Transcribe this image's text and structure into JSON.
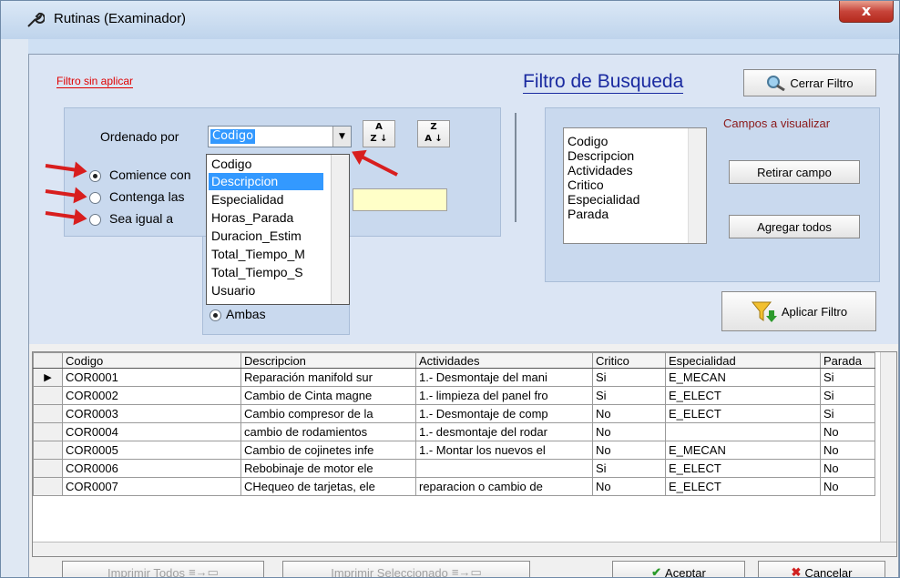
{
  "window": {
    "title": "Rutinas (Examinador)",
    "close_glyph": "x"
  },
  "filter": {
    "status": "Filtro sin aplicar",
    "title": "Filtro de Busqueda",
    "close_filter_label": "Cerrar Filtro",
    "order_label": "Ordenado por",
    "order_value": "Codigo",
    "sort_asc": [
      "A",
      "Z"
    ],
    "sort_desc": [
      "Z",
      "A"
    ],
    "match_options": [
      "Comience con",
      "Contenga las",
      "Sea igual a"
    ],
    "match_selected": 0,
    "both_label": "Ambas",
    "order_options": [
      "Codigo",
      "Descripcion",
      "Especialidad",
      "Horas_Parada",
      "Duracion_Estim",
      "Total_Tiempo_M",
      "Total_Tiempo_S",
      "Usuario"
    ],
    "order_highlight": 1,
    "fields_title": "Campos a visualizar",
    "fields": [
      "Codigo",
      "Descripcion",
      "Actividades",
      "Critico",
      "Especialidad",
      "Parada"
    ],
    "remove_field_label": "Retirar campo",
    "add_all_label": "Agregar todos",
    "apply_label": "Aplicar Filtro"
  },
  "grid": {
    "columns": [
      "Codigo",
      "Descripcion",
      "Actividades",
      "Critico",
      "Especialidad",
      "Parada"
    ],
    "rows": [
      [
        "COR0001",
        "Reparación manifold sur",
        "1.- Desmontaje del mani",
        "Si",
        "E_MECAN",
        "Si"
      ],
      [
        "COR0002",
        "Cambio de Cinta magne",
        "1.- limpieza  del panel fro",
        "Si",
        "E_ELECT",
        "Si"
      ],
      [
        "COR0003",
        "Cambio compresor de la",
        "1.- Desmontaje de comp",
        "No",
        "E_ELECT",
        "Si"
      ],
      [
        "COR0004",
        "cambio de rodamientos",
        "1.- desmontaje del rodar",
        "No",
        "",
        "No"
      ],
      [
        "COR0005",
        "Cambio de cojinetes infe",
        "1.- Montar los nuevos el",
        "No",
        "E_MECAN",
        "No"
      ],
      [
        "COR0006",
        "Rebobinaje de motor ele",
        "",
        "Si",
        "E_ELECT",
        "No"
      ],
      [
        "COR0007",
        "CHequeo de tarjetas, ele",
        "reparacion o cambio de",
        "No",
        "E_ELECT",
        "No"
      ]
    ],
    "current_row": 0
  },
  "footer": {
    "print_all": "Imprimir Todos",
    "print_selected": "Imprimir Seleccionado",
    "accept": "Aceptar",
    "cancel": "Cancelar"
  }
}
